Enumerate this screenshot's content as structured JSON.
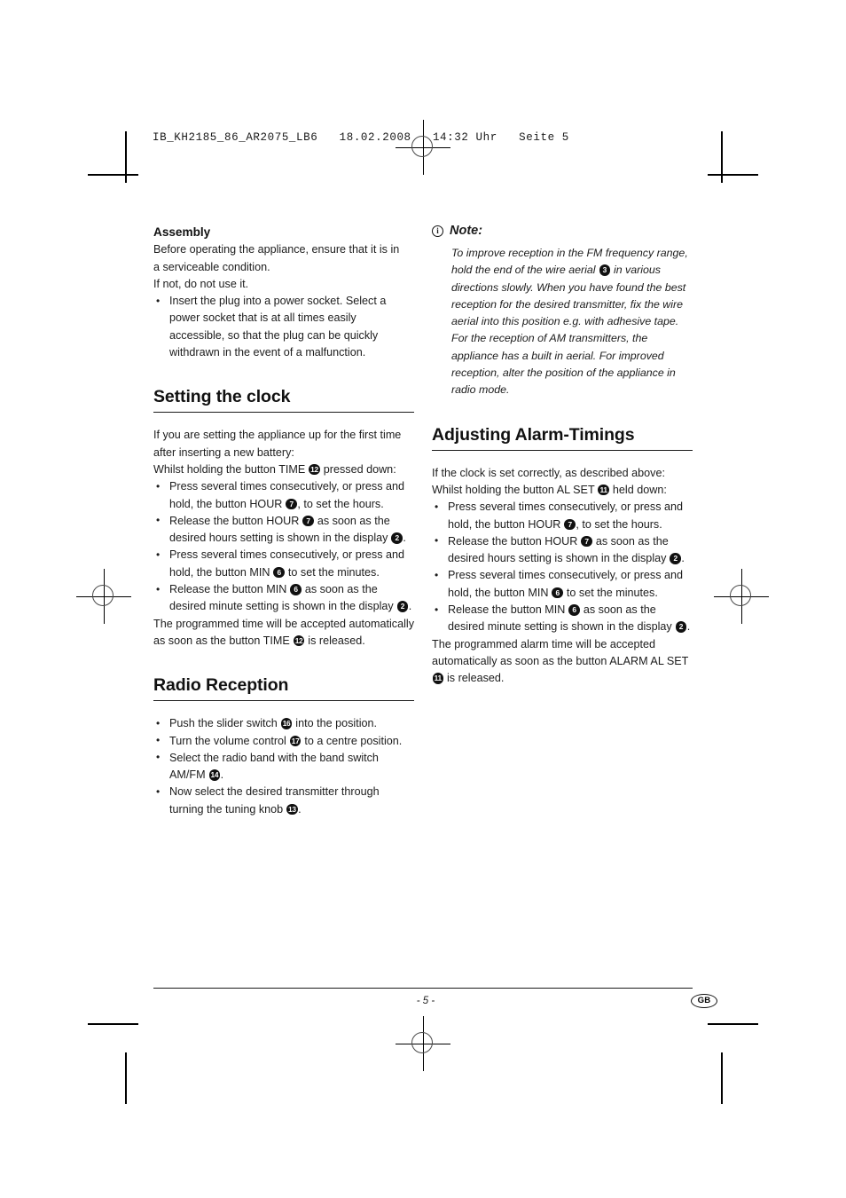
{
  "print_marks": {
    "slug": "IB_KH2185_86_AR2075_LB6   18.02.2008   14:32 Uhr   Seite 5"
  },
  "left_column": {
    "assembly": {
      "heading": "Assembly",
      "paragraphs": [
        "Before operating the appliance, ensure that it is in",
        "a serviceable condition.",
        "If not, do not use it."
      ],
      "bullets": [
        "Insert the plug into a power socket. Select a power socket that is at all times easily accessible, so that the plug can be quickly withdrawn in the event of a malfunction."
      ]
    },
    "setting_the_clock": {
      "heading": "Setting the clock",
      "intro_line_1": "If you are setting the appliance up for the first time",
      "intro_line_2": "after inserting a new battery:",
      "intro_line_3_pre": "Whilst holding the button TIME",
      "intro_line_3_badge": "12",
      "intro_line_3_post": "pressed down:",
      "bullets": [
        {
          "pre": "Press several times consecutively, or press and hold, the button HOUR",
          "badge": "7",
          "post": ", to set the hours."
        },
        {
          "pre": "Release the button HOUR",
          "badge": "7",
          "mid": "as soon as the desired hours setting is shown in the display",
          "badge2": "2",
          "post": "."
        },
        {
          "pre": "Press several times consecutively, or press and hold, the button MIN",
          "badge": "6",
          "post": "to set the minutes."
        },
        {
          "pre": "Release the button MIN",
          "badge": "6",
          "mid": "as soon as the desired minute setting is shown in the display",
          "badge2": "2",
          "post": "."
        }
      ],
      "closing_pre": "The programmed time will be accepted automatically as soon as the button TIME",
      "closing_badge": "12",
      "closing_post": "is released."
    },
    "radio_reception": {
      "heading": "Radio Reception",
      "bullets": [
        {
          "pre": "Push the slider switch",
          "badge": "16",
          "post": "into the position."
        },
        {
          "pre": "Turn the volume control",
          "badge": "17",
          "post": "to a centre position."
        },
        {
          "pre": "Select the radio band with the band switch AM/FM",
          "badge": "14",
          "post": "."
        },
        {
          "pre": "Now select the desired transmitter through turning the tuning knob",
          "badge": "13",
          "post": "."
        }
      ]
    }
  },
  "right_column": {
    "note": {
      "icon": "info-circle-icon",
      "title": "Note:",
      "body_pre": "To improve reception in the FM frequency range, hold the end of the wire aerial",
      "body_badge": "3",
      "body_post": "in various directions slowly. When you have found the best reception for the desired transmitter, fix the wire aerial into this position e.g. with adhesive tape. For the reception of AM transmitters, the appliance has a built in aerial. For improved reception, alter the position of the appliance in radio mode."
    },
    "adjusting_alarm_timings": {
      "heading": "Adjusting Alarm-Timings",
      "intro_line_1": "If the clock is set correctly, as described above:",
      "intro_line_2_pre": "Whilst holding the button AL SET",
      "intro_line_2_badge": "11",
      "intro_line_2_post": "held down:",
      "bullets": [
        {
          "pre": "Press several times consecutively, or press and hold, the button HOUR",
          "badge": "7",
          "post": ", to set the hours."
        },
        {
          "pre": "Release the button HOUR",
          "badge": "7",
          "mid": "as soon as the desired hours setting is shown in the display",
          "badge2": "2",
          "post": "."
        },
        {
          "pre": "Press several times consecutively, or press and hold, the button MIN",
          "badge": "6",
          "post": "to set the minutes."
        },
        {
          "pre": "Release the button MIN",
          "badge": "6",
          "mid": "as soon as the desired minute setting is shown in the display",
          "badge2": "2",
          "post": "."
        }
      ],
      "closing_pre": "The programmed alarm time will be accepted automatically as soon as the button ALARM AL SET",
      "closing_badge": "11",
      "closing_post": "is released."
    }
  },
  "footer": {
    "page_number": "- 5 -",
    "language": "GB"
  }
}
